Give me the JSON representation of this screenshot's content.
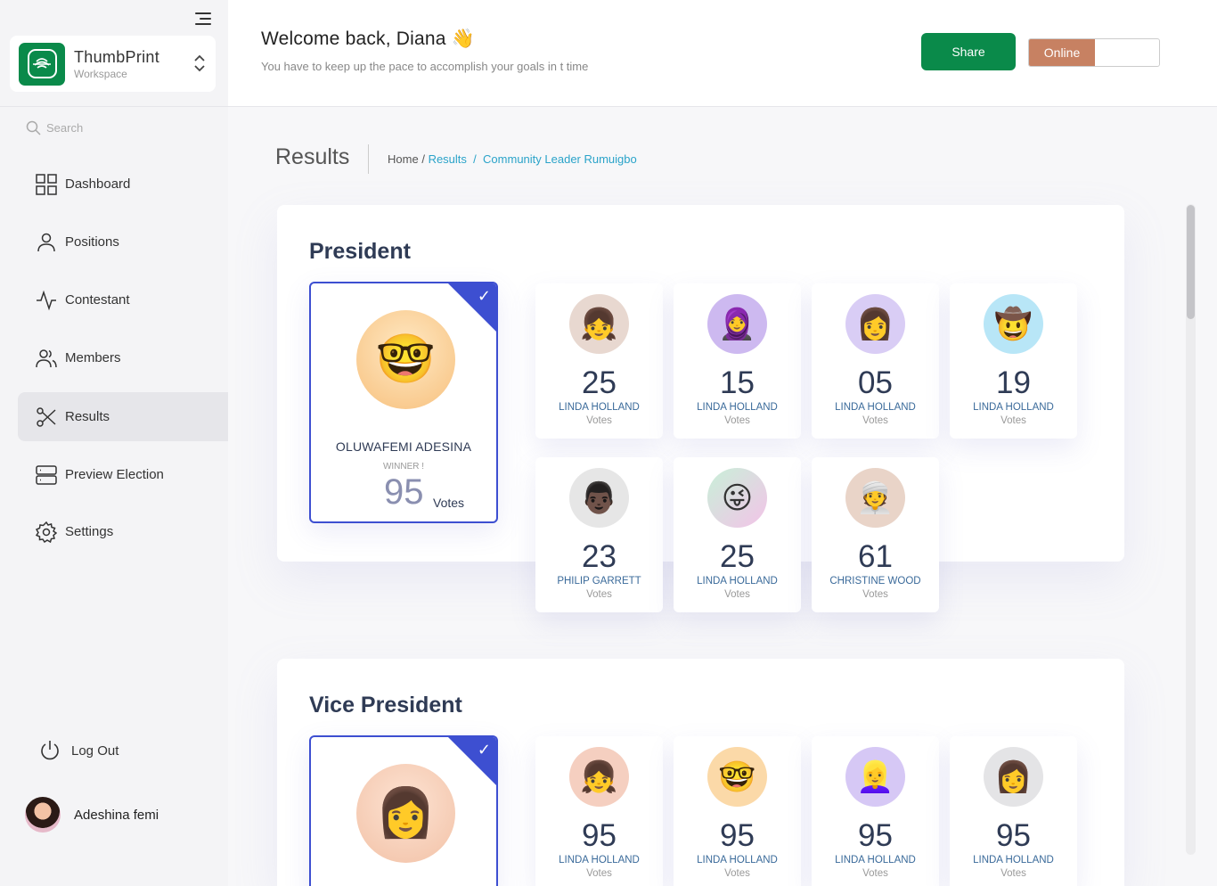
{
  "sidebar": {
    "workspace_name": "ThumbPrint",
    "workspace_sub": "Workspace",
    "search_placeholder": "Search",
    "items": [
      {
        "label": "Dashboard"
      },
      {
        "label": "Positions"
      },
      {
        "label": "Contestant"
      },
      {
        "label": "Members"
      },
      {
        "label": "Results"
      },
      {
        "label": "Preview Election"
      },
      {
        "label": "Settings"
      }
    ],
    "logout_label": "Log Out",
    "user_name": "Adeshina femi"
  },
  "header": {
    "welcome": "Welcome back, Diana 👋",
    "subtitle": "You have to keep up the pace to accomplish your goals in t time",
    "share_label": "Share",
    "status_label": "Online"
  },
  "page": {
    "title": "Results",
    "breadcrumb_home": "Home",
    "breadcrumb_sep": "/",
    "breadcrumb_results": "Results",
    "breadcrumb_current": "Community Leader Rumuigbo"
  },
  "president": {
    "title": "President",
    "winner": {
      "name": "OLUWAFEMI ADESINA",
      "label": "WINNER !",
      "votes": "95",
      "votes_label": "Votes",
      "avatar": "🤓"
    },
    "candidates": [
      {
        "votes": "25",
        "name": "LINDA HOLLAND",
        "label": "Votes",
        "avatar": "👧"
      },
      {
        "votes": "15",
        "name": "LINDA HOLLAND",
        "label": "Votes",
        "avatar": "🧕"
      },
      {
        "votes": "05",
        "name": "LINDA HOLLAND",
        "label": "Votes",
        "avatar": "👩"
      },
      {
        "votes": "19",
        "name": "LINDA HOLLAND",
        "label": "Votes",
        "avatar": "🤠"
      },
      {
        "votes": "23",
        "name": "PHILIP GARRETT",
        "label": "Votes",
        "avatar": "👨🏿"
      },
      {
        "votes": "25",
        "name": "LINDA HOLLAND",
        "label": "Votes",
        "avatar": "😜"
      },
      {
        "votes": "61",
        "name": "CHRISTINE WOOD",
        "label": "Votes",
        "avatar": "👳"
      }
    ]
  },
  "vice_president": {
    "title": "Vice President",
    "winner": {
      "avatar": "👩"
    },
    "candidates": [
      {
        "votes": "95",
        "name": "LINDA HOLLAND",
        "label": "Votes",
        "avatar": "👧"
      },
      {
        "votes": "95",
        "name": "LINDA HOLLAND",
        "label": "Votes",
        "avatar": "🤓"
      },
      {
        "votes": "95",
        "name": "LINDA HOLLAND",
        "label": "Votes",
        "avatar": "👱‍♀️"
      },
      {
        "votes": "95",
        "name": "LINDA HOLLAND",
        "label": "Votes",
        "avatar": "👩"
      }
    ]
  },
  "colors": {
    "brand_green": "#0a8a4a",
    "online_badge": "#c78162",
    "winner_border": "#3d4fd1",
    "link": "#2aa3c9"
  }
}
